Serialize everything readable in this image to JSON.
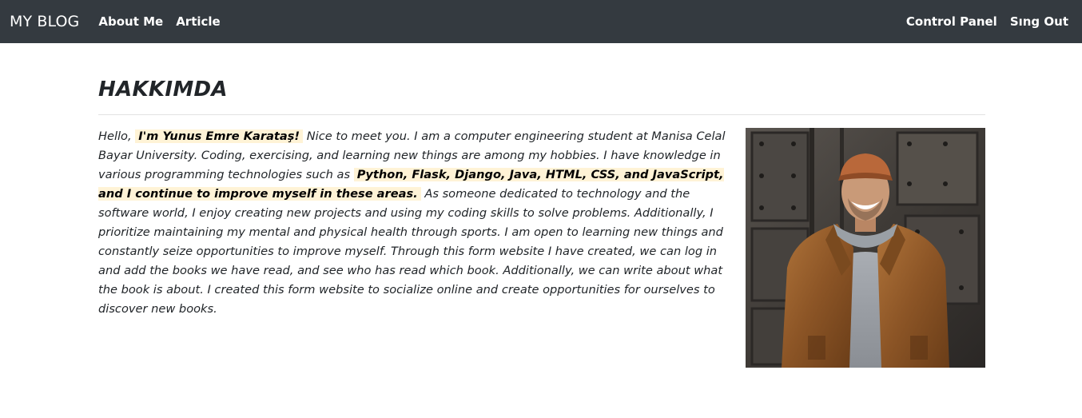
{
  "navbar": {
    "brand": "MY BLOG",
    "links": [
      "About Me",
      "Article"
    ],
    "right_links": [
      "Control Panel",
      "Sıng Out"
    ],
    "background": "#343a40"
  },
  "page": {
    "title": "HAKKIMDA"
  },
  "about": {
    "part1": "Hello,",
    "highlight1": "I'm Yunus Emre Karataş!",
    "part2": "Nice to meet you. I am a computer engineering student at Manisa Celal Bayar University. Coding, exercising, and learning new things are among my hobbies. I have knowledge in various programming technologies such as",
    "highlight2": "Python, Flask, Django, Java, HTML, CSS, and JavaScript, and I continue to improve myself in these areas.",
    "part3": "As someone dedicated to technology and the software world, I enjoy creating new projects and using my coding skills to solve problems. Additionally, I prioritize maintaining my mental and physical health through sports. I am open to learning new things and constantly seize opportunities to improve myself. Through this form website I have created, we can log in and add the books we have read, and see who has read which book. Additionally, we can write about what the book is about. I created this form website to socialize online and create opportunities for ourselves to discover new books.",
    "highlight_color": "#fff3d6"
  },
  "photo": {
    "subject": "smiling person in brown cap and brown jacket"
  }
}
